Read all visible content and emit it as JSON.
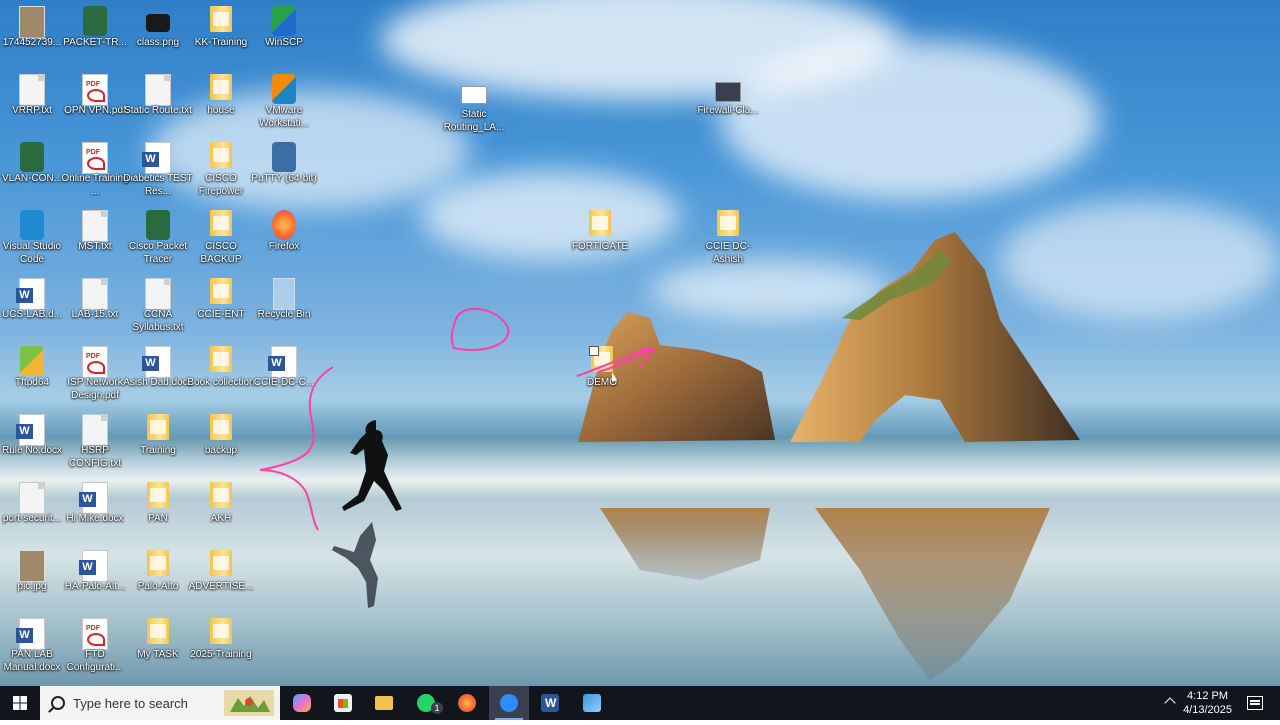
{
  "desktop": {
    "icons": [
      {
        "label": "174452739...",
        "type": "image"
      },
      {
        "label": "PACKET-TR...",
        "type": "packet-tracer"
      },
      {
        "label": "class.png",
        "type": "image"
      },
      {
        "label": "KK-Training",
        "type": "folder"
      },
      {
        "label": "WinSCP",
        "type": "winscp"
      },
      {
        "label": "VRRP.txt",
        "type": "text"
      },
      {
        "label": "OPN VPN.pdf",
        "type": "pdf"
      },
      {
        "label": "Static Route.txt",
        "type": "text"
      },
      {
        "label": "house",
        "type": "folder"
      },
      {
        "label": "VMware Workstati...",
        "type": "vmware"
      },
      {
        "label": "VLAN-CON...",
        "type": "packet-tracer"
      },
      {
        "label": "Online Training ...",
        "type": "pdf"
      },
      {
        "label": "Diabetics TEST Res...",
        "type": "word"
      },
      {
        "label": "CISCO Firepower",
        "type": "folder"
      },
      {
        "label": "PuTTY (64-bit)",
        "type": "putty"
      },
      {
        "label": "Visual Studio Code",
        "type": "vscode"
      },
      {
        "label": "MST.txt",
        "type": "text"
      },
      {
        "label": "Cisco Packet Tracer",
        "type": "packet-tracer"
      },
      {
        "label": "CISCO BACKUP",
        "type": "folder"
      },
      {
        "label": "Firefox",
        "type": "firefox"
      },
      {
        "label": "UCS-LAB.d...",
        "type": "word"
      },
      {
        "label": "LAB-15.txt",
        "type": "text"
      },
      {
        "label": "CCNA Syllabus.txt",
        "type": "text"
      },
      {
        "label": "CCIE-ENT",
        "type": "folder"
      },
      {
        "label": "Recycle Bin",
        "type": "recycle"
      },
      {
        "label": "Tftpd64",
        "type": "tftpd"
      },
      {
        "label": "ISP Network Design.pdf",
        "type": "pdf"
      },
      {
        "label": "Asish Dad.docx",
        "type": "word"
      },
      {
        "label": "Book collection",
        "type": "folder"
      },
      {
        "label": "CCIE-DC-C...",
        "type": "word"
      },
      {
        "label": "Rule No.docx",
        "type": "word"
      },
      {
        "label": "HSRP CONFIG.txt",
        "type": "text"
      },
      {
        "label": "Training",
        "type": "folder"
      },
      {
        "label": "backup",
        "type": "folder"
      },
      {
        "label": "port-securit...",
        "type": "text"
      },
      {
        "label": "Hi Mike.docx",
        "type": "word"
      },
      {
        "label": "PAN",
        "type": "folder"
      },
      {
        "label": "AKH",
        "type": "folder"
      },
      {
        "label": "pic.jpg",
        "type": "image"
      },
      {
        "label": "HA-Palo-Alt...",
        "type": "word"
      },
      {
        "label": "Palo-Alto",
        "type": "folder"
      },
      {
        "label": "ADVERTISE...",
        "type": "folder"
      },
      {
        "label": "PAN LAB Manual.docx",
        "type": "word"
      },
      {
        "label": "FTD Configurati...",
        "type": "pdf"
      },
      {
        "label": "My TASK",
        "type": "folder"
      },
      {
        "label": "2025-Training",
        "type": "folder"
      },
      {
        "label": "Static Routing_LA...",
        "type": "screenshot"
      },
      {
        "label": "Firewall-Cla...",
        "type": "screenshot"
      },
      {
        "label": "FORTIGATE",
        "type": "folder"
      },
      {
        "label": "CCIE DC-Ashish",
        "type": "folder"
      },
      {
        "label": "DEMO",
        "type": "folder"
      }
    ]
  },
  "taskbar": {
    "search_placeholder": "Type here to search",
    "apps": [
      {
        "name": "copilot-icon",
        "color": "#e86dd4"
      },
      {
        "name": "microsoft-store-icon",
        "color": "#f0f0f0"
      },
      {
        "name": "file-explorer-icon",
        "color": "#f3c44d"
      },
      {
        "name": "whatsapp-icon",
        "color": "#25d366",
        "badge": "1"
      },
      {
        "name": "firefox-icon",
        "color": "#ff7139"
      },
      {
        "name": "zoom-icon",
        "color": "#2d8cff",
        "active": true
      },
      {
        "name": "word-icon",
        "color": "#2b579a"
      },
      {
        "name": "paint-icon",
        "color": "#3a96dd"
      }
    ],
    "whatsapp_badge": "1",
    "time": "4:12 PM",
    "date": "4/13/2025"
  },
  "colors": {
    "taskbar": "#12151c",
    "annotation": "#ff3fa8"
  }
}
